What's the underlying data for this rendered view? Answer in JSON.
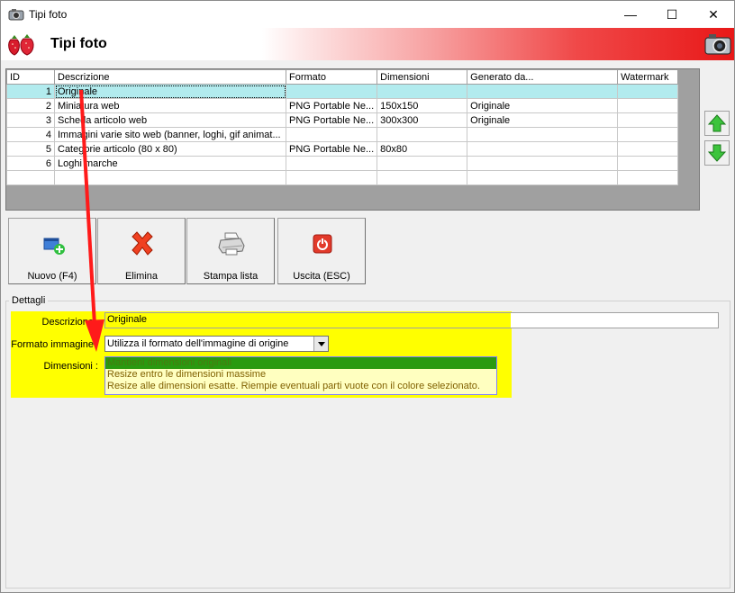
{
  "window": {
    "title": "Tipi foto",
    "controls": {
      "minimize": "—",
      "maximize": "☐",
      "close": "✕"
    }
  },
  "header": {
    "title": "Tipi foto"
  },
  "grid": {
    "columns": [
      "ID",
      "Descrizione",
      "Formato",
      "Dimensioni",
      "Generato da...",
      "Watermark"
    ],
    "rows": [
      {
        "id": "1",
        "descrizione": "Originale",
        "formato": "",
        "dimensioni": "",
        "generato": "",
        "watermark": "",
        "selected": true
      },
      {
        "id": "2",
        "descrizione": "Miniatura web",
        "formato": "PNG Portable Ne...",
        "dimensioni": "150x150",
        "generato": "Originale",
        "watermark": ""
      },
      {
        "id": "3",
        "descrizione": "Scheda articolo web",
        "formato": "PNG Portable Ne...",
        "dimensioni": "300x300",
        "generato": "Originale",
        "watermark": ""
      },
      {
        "id": "4",
        "descrizione": "Immagini varie sito web (banner, loghi, gif animat...",
        "formato": "",
        "dimensioni": "",
        "generato": "",
        "watermark": ""
      },
      {
        "id": "5",
        "descrizione": "Categorie articolo (80 x 80)",
        "formato": "PNG Portable Ne...",
        "dimensioni": "80x80",
        "generato": "",
        "watermark": ""
      },
      {
        "id": "6",
        "descrizione": "Loghi marche",
        "formato": "",
        "dimensioni": "",
        "generato": "",
        "watermark": ""
      },
      {
        "id": "",
        "descrizione": "",
        "formato": "",
        "dimensioni": "",
        "generato": "",
        "watermark": ""
      }
    ]
  },
  "toolbar": {
    "nuovo": "Nuovo (F4)",
    "elimina": "Elimina",
    "stampa": "Stampa lista",
    "uscita": "Uscita (ESC)"
  },
  "details": {
    "legend": "Dettagli",
    "descrizione_label": "Descrizione",
    "descrizione_value": "Originale",
    "formato_label": "Formato immagine",
    "formato_value": "Utilizza il formato dell'immagine di origine",
    "dimensioni_label": "Dimensioni :",
    "dimensioni_options": [
      "Mantieni dimensioni originali",
      "Resize entro le dimensioni massime",
      "Resize alle dimensioni esatte. Riempie eventuali parti vuote con il colore selezionato."
    ],
    "dimensioni_selected": 0
  },
  "colors": {
    "highlight": "#ffff00",
    "selected_row": "#b2ebee",
    "header_red": "#e81818",
    "arrow_red": "#ff1a1a",
    "list_selected": "#2a9a10"
  }
}
